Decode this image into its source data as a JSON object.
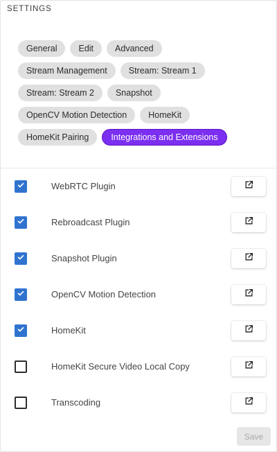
{
  "header": {
    "title": "SETTINGS"
  },
  "tabs": [
    {
      "label": "General",
      "active": false
    },
    {
      "label": "Edit",
      "active": false
    },
    {
      "label": "Advanced",
      "active": false
    },
    {
      "label": "Stream Management",
      "active": false
    },
    {
      "label": "Stream: Stream 1",
      "active": false
    },
    {
      "label": "Stream: Stream 2",
      "active": false
    },
    {
      "label": "Snapshot",
      "active": false
    },
    {
      "label": "OpenCV Motion Detection",
      "active": false
    },
    {
      "label": "HomeKit",
      "active": false
    },
    {
      "label": "HomeKit Pairing",
      "active": false
    },
    {
      "label": "Integrations and Extensions",
      "active": true
    }
  ],
  "integrations": [
    {
      "label": "WebRTC Plugin",
      "checked": true,
      "icon": "open-in-new-icon"
    },
    {
      "label": "Rebroadcast Plugin",
      "checked": true,
      "icon": "open-in-new-icon"
    },
    {
      "label": "Snapshot Plugin",
      "checked": true,
      "icon": "open-in-new-icon"
    },
    {
      "label": "OpenCV Motion Detection",
      "checked": true,
      "icon": "open-in-new-icon"
    },
    {
      "label": "HomeKit",
      "checked": true,
      "icon": "open-in-new-icon"
    },
    {
      "label": "HomeKit Secure Video Local Copy",
      "checked": false,
      "icon": "open-in-new-icon"
    },
    {
      "label": "Transcoding",
      "checked": false,
      "icon": "open-in-new-icon"
    }
  ],
  "actions": {
    "save_label": "Save",
    "save_disabled": true
  },
  "colors": {
    "accent": "#7b2ff0",
    "checkbox": "#2f73cf",
    "chip": "#e0e0e0"
  }
}
